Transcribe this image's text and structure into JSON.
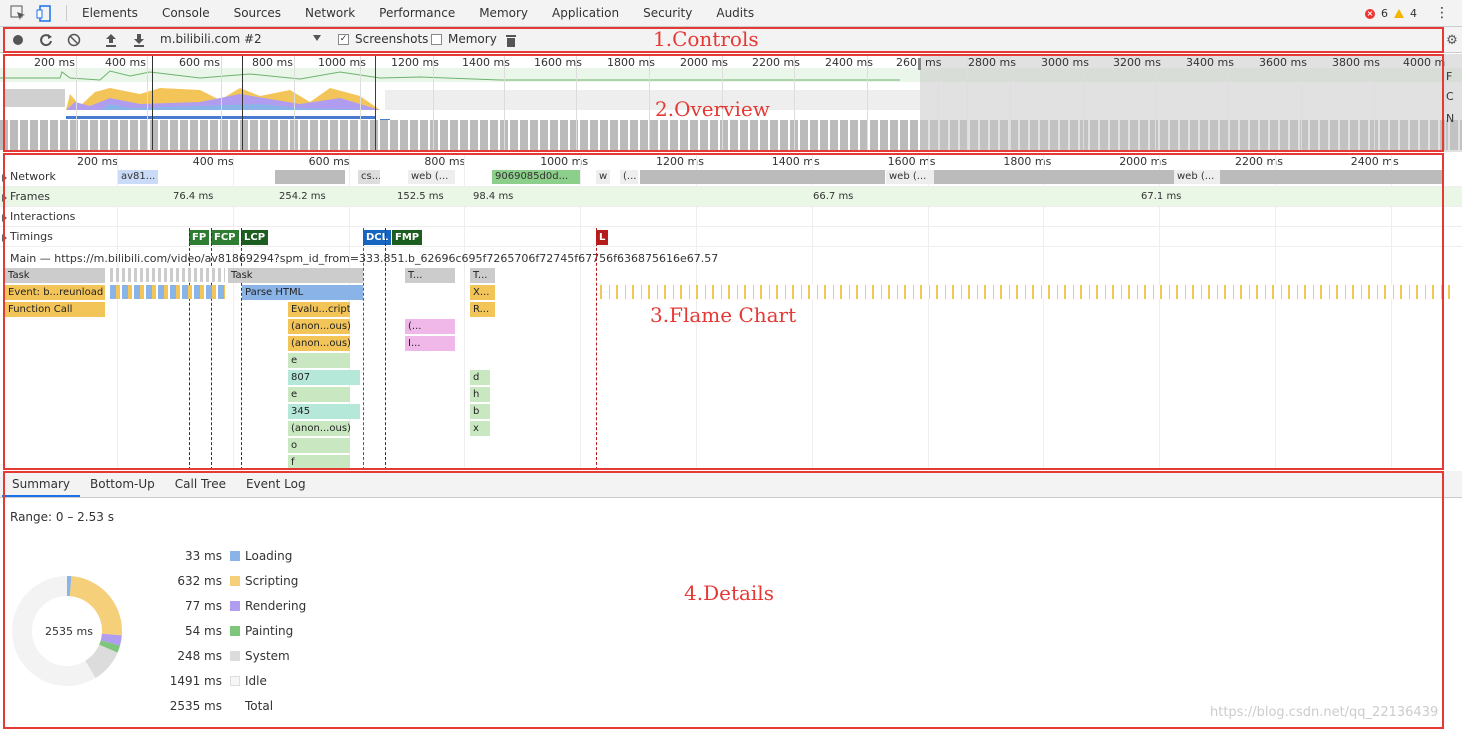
{
  "devtools": {
    "tabs": [
      "Elements",
      "Console",
      "Sources",
      "Network",
      "Performance",
      "Memory",
      "Application",
      "Security",
      "Audits"
    ],
    "errors": "6",
    "warnings": "4"
  },
  "controls": {
    "target": "m.bilibili.com #2",
    "screenshots_label": "Screenshots",
    "memory_label": "Memory"
  },
  "overview": {
    "ticks": [
      "200 ms",
      "400 ms",
      "600 ms",
      "800 ms",
      "1000 ms",
      "1200 ms",
      "1400 ms",
      "1600 ms",
      "1800 ms",
      "2000 ms",
      "2200 ms",
      "2400 ms",
      "260",
      "ms",
      "2800 ms",
      "3000 ms",
      "3200 ms",
      "3400 ms",
      "3600 ms",
      "3800 ms",
      "4000 m"
    ],
    "lane_labels": [
      "F",
      "C",
      "N"
    ]
  },
  "flame": {
    "ticks": [
      "200 ms",
      "400 ms",
      "600 ms",
      "800 ms",
      "1000 ms",
      "1200 ms",
      "1400 ms",
      "1600 ms",
      "1800 ms",
      "2000 ms",
      "2200 ms",
      "2400 ms"
    ],
    "tracks": [
      "Network",
      "Frames",
      "Interactions",
      "Timings"
    ],
    "network_items": [
      "av81...",
      "cs...",
      "web (...",
      "9069085d0d...",
      "w",
      "(...",
      "web (...",
      "web (..."
    ],
    "frames": [
      "76.4 ms",
      "254.2 ms",
      "152.5 ms",
      "98.4 ms",
      "66.7 ms",
      "67.1 ms"
    ],
    "timings": [
      "FP",
      "FCP",
      "LCP",
      "DCL",
      "FMP",
      "L"
    ],
    "main_header": "Main — https://m.bilibili.com/video/av81869294?spm_id_from=333.851.b_62696c695f7265706f72745f67756f636875616e67.57",
    "col1": [
      "Task",
      "Event: b...reunload",
      "Function Call"
    ],
    "col2": [
      "Task",
      "Parse HTML"
    ],
    "stack": [
      "Evalu...cript",
      "(anon...ous)",
      "(anon...ous)",
      "e",
      "807",
      "e",
      "345",
      "(anon...ous)",
      "o",
      "f"
    ],
    "col4": [
      "T...",
      "(...",
      "I..."
    ],
    "col5": [
      "T...",
      "X...",
      "R...",
      "d",
      "h",
      "b",
      "x"
    ]
  },
  "details": {
    "tabs": [
      "Summary",
      "Bottom-Up",
      "Call Tree",
      "Event Log"
    ],
    "range": "Range: 0 – 2.53 s",
    "total_center": "2535 ms",
    "rows": [
      {
        "value": "33 ms",
        "name": "Loading",
        "color": "#8ab4e8"
      },
      {
        "value": "632 ms",
        "name": "Scripting",
        "color": "#f5cf79"
      },
      {
        "value": "77 ms",
        "name": "Rendering",
        "color": "#b19df0"
      },
      {
        "value": "54 ms",
        "name": "Painting",
        "color": "#7dc67b"
      },
      {
        "value": "248 ms",
        "name": "System",
        "color": "#dcdcdc"
      },
      {
        "value": "1491 ms",
        "name": "Idle",
        "color": "#f6f6f6"
      },
      {
        "value": "2535 ms",
        "name": "Total",
        "color": ""
      }
    ]
  },
  "annotations": [
    "1.Controls",
    "2.Overview",
    "3.Flame Chart",
    "4.Details"
  ],
  "watermark": "https://blog.csdn.net/qq_22136439"
}
